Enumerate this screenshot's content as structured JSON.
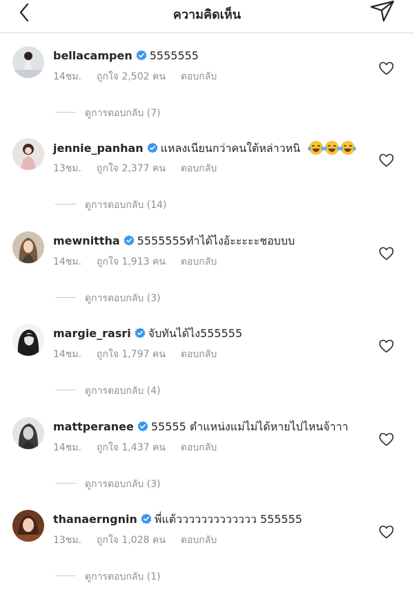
{
  "header": {
    "title": "ความคิดเห็น"
  },
  "comments": [
    {
      "username": "bellacampen",
      "text": "5555555",
      "time": "14ชม.",
      "likes": "ถูกใจ 2,502 คน",
      "reply": "ตอบกลับ",
      "view_replies": "ดูการตอบกลับ (7)"
    },
    {
      "username": "jennie_panhan",
      "text": "แหลงเนียนกว่าคนใต้หล่าวหนิ",
      "time": "13ชม.",
      "likes": "ถูกใจ 2,377 คน",
      "reply": "ตอบกลับ",
      "view_replies": "ดูการตอบกลับ (14)"
    },
    {
      "username": "mewnittha",
      "text": "5555555ทำได้ไงอ้ะะะะะชอบบบ",
      "time": "14ชม.",
      "likes": "ถูกใจ 1,913 คน",
      "reply": "ตอบกลับ",
      "view_replies": "ดูการตอบกลับ (3)"
    },
    {
      "username": "margie_rasri",
      "text": "จับทันได้ไง555555",
      "time": "14ชม.",
      "likes": "ถูกใจ 1,797 คน",
      "reply": "ตอบกลับ",
      "view_replies": "ดูการตอบกลับ (4)"
    },
    {
      "username": "mattperanee",
      "text": "55555 ตำแหน่งแม่ไม่ได้หายไปไหนจ้าาา",
      "time": "14ชม.",
      "likes": "ถูกใจ 1,437 คน",
      "reply": "ตอบกลับ",
      "view_replies": "ดูการตอบกลับ (3)"
    },
    {
      "username": "thanaerngnin",
      "text": "พี่แต้ววววววววววววว 555555",
      "time": "13ชม.",
      "likes": "ถูกใจ 1,028 คน",
      "reply": "ตอบกลับ",
      "view_replies": "ดูการตอบกลับ (1)"
    }
  ],
  "colors": {
    "verified": "#3897f0",
    "secondary_text": "#8e8e8e",
    "primary_text": "#262626",
    "emoji": "#f9c22e"
  },
  "icons": {
    "back": "chevron-left-icon",
    "send": "paper-plane-icon",
    "verified": "verified-badge-icon",
    "like": "heart-outline-icon",
    "emoji": "face-with-tears-of-joy-emoji"
  }
}
